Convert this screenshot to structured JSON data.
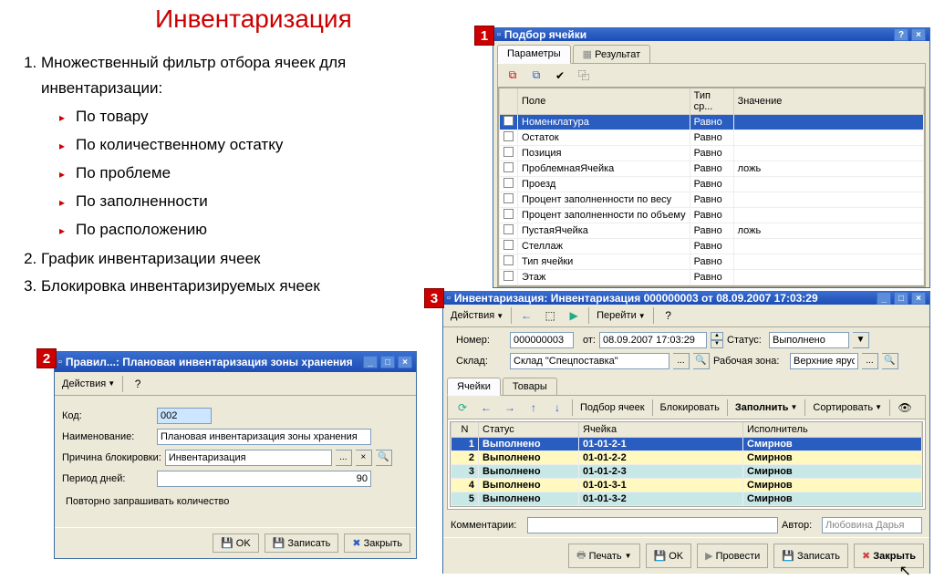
{
  "slide": {
    "title": "Инвентаризация",
    "items": [
      "Множественный фильтр отбора ячеек для инвентаризации:",
      "График инвентаризации ячеек",
      "Блокировка инвентаризируемых ячеек"
    ],
    "sub": [
      "По товару",
      "По количественному остатку",
      "По проблеме",
      "По заполненности",
      "По расположению"
    ]
  },
  "badges": {
    "b1": "1",
    "b2": "2",
    "b3": "3"
  },
  "win1": {
    "title": "Подбор ячейки",
    "tabs": [
      "Параметры",
      "Результат"
    ],
    "cols": [
      "Поле",
      "Тип ср...",
      "Значение"
    ],
    "rows": [
      {
        "f": "Номенклатура",
        "t": "Равно",
        "v": "",
        "sel": true
      },
      {
        "f": "Остаток",
        "t": "Равно",
        "v": ""
      },
      {
        "f": "Позиция",
        "t": "Равно",
        "v": ""
      },
      {
        "f": "ПроблемнаяЯчейка",
        "t": "Равно",
        "v": "ложь"
      },
      {
        "f": "Проезд",
        "t": "Равно",
        "v": ""
      },
      {
        "f": "Процент заполненности по весу",
        "t": "Равно",
        "v": ""
      },
      {
        "f": "Процент заполненности по объему",
        "t": "Равно",
        "v": ""
      },
      {
        "f": "ПустаяЯчейка",
        "t": "Равно",
        "v": "ложь"
      },
      {
        "f": "Стеллаж",
        "t": "Равно",
        "v": ""
      },
      {
        "f": "Тип ячейки",
        "t": "Равно",
        "v": ""
      },
      {
        "f": "Этаж",
        "t": "Равно",
        "v": ""
      }
    ]
  },
  "win2": {
    "title": "Правил...: Плановая инвентаризация зоны хранения",
    "actions_label": "Действия",
    "labels": {
      "code": "Код:",
      "name": "Наименование:",
      "reason": "Причина блокировки:",
      "period": "Период дней:",
      "repeat": "Повторно запрашивать количество"
    },
    "values": {
      "code": "002",
      "name": "Плановая инвентаризация зоны хранения",
      "reason": "Инвентаризация",
      "period": "90"
    },
    "buttons": {
      "ok": "OK",
      "save": "Записать",
      "close": "Закрыть"
    }
  },
  "win3": {
    "title": "Инвентаризация: Инвентаризация 000000003 от 08.09.2007 17:03:29",
    "toolbar": {
      "actions": "Действия",
      "goto": "Перейти"
    },
    "labels": {
      "num": "Номер:",
      "from": "от:",
      "status": "Статус:",
      "sklad": "Склад:",
      "zone": "Рабочая зона:",
      "comments": "Комментарии:",
      "author": "Автор:"
    },
    "values": {
      "num": "000000003",
      "date": "08.09.2007 17:03:29",
      "status": "Выполнено",
      "sklad": "Склад \"Спецпоставка\"",
      "zone": "Верхние ярус",
      "author": "Любовина Дарья"
    },
    "tabs": [
      "Ячейки",
      "Товары"
    ],
    "toolbar2": {
      "pick": "Подбор ячеек",
      "block": "Блокировать",
      "fill": "Заполнить",
      "sort": "Сортировать"
    },
    "cols": [
      "N",
      "Статус",
      "Ячейка",
      "Исполнитель"
    ],
    "rows": [
      {
        "n": "1",
        "s": "Выполнено",
        "c": "01-01-2-1",
        "e": "Смирнов",
        "cls": "sel"
      },
      {
        "n": "2",
        "s": "Выполнено",
        "c": "01-01-2-2",
        "e": "Смирнов",
        "cls": "row-yellow"
      },
      {
        "n": "3",
        "s": "Выполнено",
        "c": "01-01-2-3",
        "e": "Смирнов",
        "cls": "row-teal"
      },
      {
        "n": "4",
        "s": "Выполнено",
        "c": "01-01-3-1",
        "e": "Смирнов",
        "cls": "row-yellow"
      },
      {
        "n": "5",
        "s": "Выполнено",
        "c": "01-01-3-2",
        "e": "Смирнов",
        "cls": "row-teal"
      }
    ],
    "footer": {
      "print": "Печать",
      "ok": "OK",
      "run": "Провести",
      "save": "Записать",
      "close": "Закрыть"
    }
  }
}
